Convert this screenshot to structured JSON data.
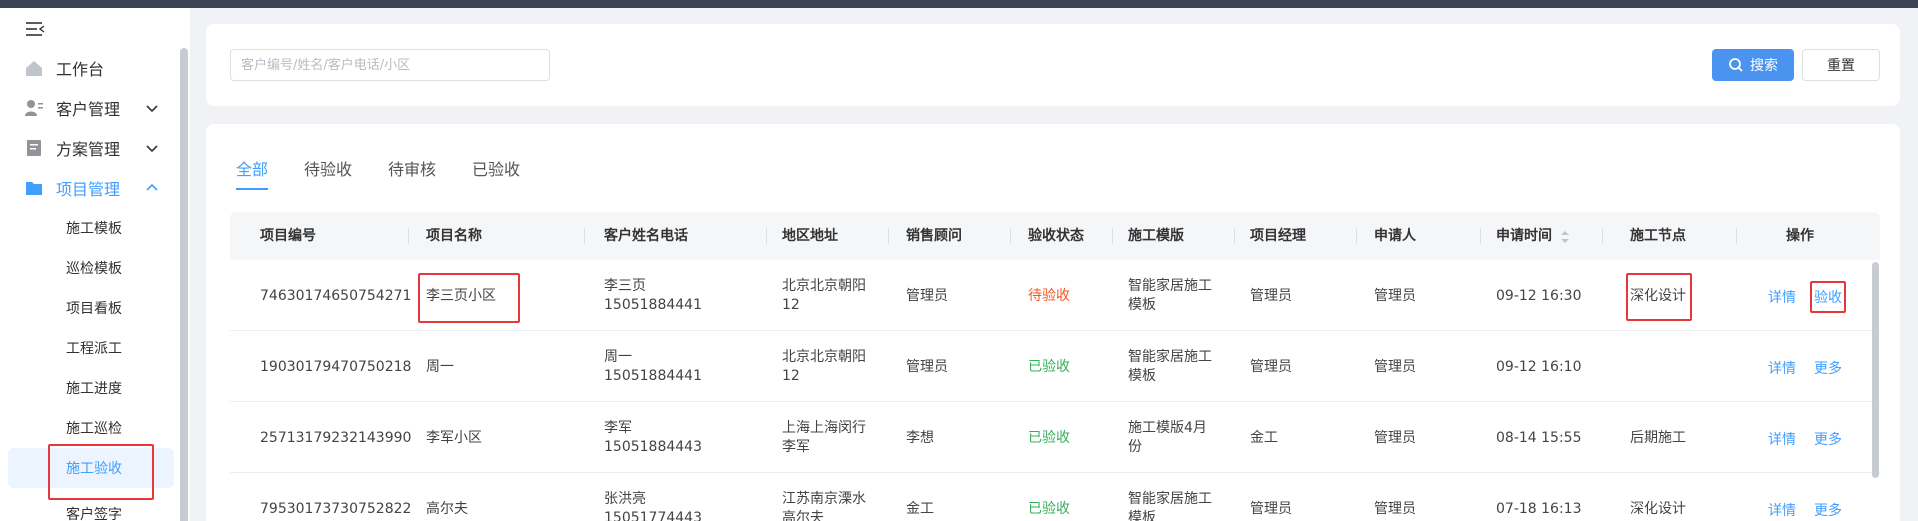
{
  "sidebar": {
    "items": [
      {
        "label": "工作台"
      },
      {
        "label": "客户管理"
      },
      {
        "label": "方案管理"
      },
      {
        "label": "项目管理"
      }
    ],
    "sub_items": [
      "施工模板",
      "巡检模板",
      "项目看板",
      "工程派工",
      "施工进度",
      "施工巡检",
      "施工验收",
      "客户签字"
    ]
  },
  "search": {
    "placeholder": "客户编号/姓名/客户电话/小区",
    "search_label": "搜索",
    "reset_label": "重置"
  },
  "tabs": [
    "全部",
    "待验收",
    "待审核",
    "已验收"
  ],
  "table": {
    "headers": [
      "项目编号",
      "项目名称",
      "客户姓名电话",
      "地区地址",
      "销售顾问",
      "验收状态",
      "施工模版",
      "项目经理",
      "申请人",
      "申请时间",
      "施工节点",
      "操作"
    ],
    "rows": [
      {
        "id": "74630174650754271",
        "name": "李三页小区",
        "customer": "李三页",
        "phone": "15051884441",
        "region1": "北京北京朝阳",
        "region2": "12",
        "sales": "管理员",
        "status": "待验收",
        "tpl1": "智能家居施工",
        "tpl2": "模板",
        "manager": "管理员",
        "applicant": "管理员",
        "time": "09-12 16:30",
        "node": "深化设计",
        "op1": "详情",
        "op2": "验收"
      },
      {
        "id": "19030179470750218",
        "name": "周一",
        "customer": "周一",
        "phone": "15051884441",
        "region1": "北京北京朝阳",
        "region2": "12",
        "sales": "管理员",
        "status": "已验收",
        "tpl1": "智能家居施工",
        "tpl2": "模板",
        "manager": "管理员",
        "applicant": "管理员",
        "time": "09-12 16:10",
        "node": "",
        "op1": "详情",
        "op2": "更多"
      },
      {
        "id": "25713179232143990",
        "name": "李军小区",
        "customer": "李军",
        "phone": "15051884443",
        "region1": "上海上海闵行",
        "region2": "李军",
        "sales": "李想",
        "status": "已验收",
        "tpl1": "施工模版4月",
        "tpl2": "份",
        "manager": "金工",
        "applicant": "管理员",
        "time": "08-14 15:55",
        "node": "后期施工",
        "op1": "详情",
        "op2": "更多"
      },
      {
        "id": "79530173730752822",
        "name": "高尔夫",
        "customer": "张洪亮",
        "phone": "15051774443",
        "region1": "江苏南京溧水",
        "region2": "高尔夫",
        "sales": "金工",
        "status": "已验收",
        "tpl1": "智能家居施工",
        "tpl2": "模板",
        "manager": "管理员",
        "applicant": "管理员",
        "time": "07-18 16:13",
        "node": "深化设计",
        "op1": "详情",
        "op2": "更多"
      }
    ]
  },
  "colors": {
    "accent": "#409eff",
    "pending": "#f5561f",
    "done": "#35b05a",
    "highlight": "#e5383b"
  }
}
